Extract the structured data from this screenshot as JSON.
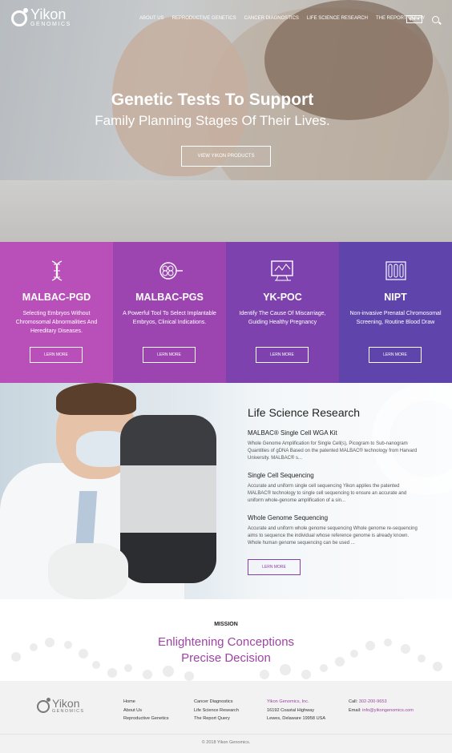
{
  "brand": {
    "name": "Yikon",
    "sub": "GENOMICS"
  },
  "nav": {
    "items": [
      "ABOUT US",
      "REPRODUCTIVE GENETICS",
      "CANCER DIAGNOSTICS",
      "LIFE SCIENCE RESEARCH",
      "THE REPORT QUERY"
    ],
    "lang": "EN",
    "lang_caret": "▾"
  },
  "hero": {
    "title": "Genetic Tests To Support",
    "subtitle": "Family Planning Stages Of Their Lives.",
    "button": "VIEW YIKON PRODUCTS"
  },
  "products": [
    {
      "title": "MALBAC-PGD",
      "desc": "Selecting Embryos Without Chromosomal Abnormalities And Hereditary Diseases.",
      "button": "LERN MORE",
      "icon": "dna-icon",
      "color": "#b94fb8"
    },
    {
      "title": "MALBAC-PGS",
      "desc": "A Powerful Tool To Select Implantable Embryos, Clinical Indications.",
      "button": "LERN MORE",
      "icon": "cells-icon",
      "color": "#9c45b0"
    },
    {
      "title": "YK-POC",
      "desc": "Identify The Cause Of Miscarriage, Guiding Healthy Pregnancy",
      "button": "LERN MORE",
      "icon": "microscope-screen-icon",
      "color": "#7d42ad"
    },
    {
      "title": "NIPT",
      "desc": "Non-invasive Prenatal Chromosomal Screening, Routine Blood Draw",
      "button": "LERN MORE",
      "icon": "test-tubes-icon",
      "color": "#5f44ab"
    }
  ],
  "life_science": {
    "heading": "Life Science Research",
    "items": [
      {
        "title": "MALBAC® Single Cell WGA Kit",
        "desc": "Whole Genome Amplification for Single Cell(s), Picogram to Sub-nanogram Quantities of gDNA Based on the patented MALBAC® technology from Harvard University. MALBAC® s..."
      },
      {
        "title": "Single Cell Sequencing",
        "desc": "Accurate and uniform single cell sequencing Yikon applies the patented MALBAC® technology to single cell sequencing to ensure an accurate and uniform whole-genome amplification of a sin..."
      },
      {
        "title": "Whole Genome Sequencing",
        "desc": "Accurate and uniform whole genome sequencing Whole genome re-sequencing aims to sequence the individual whose reference genome is already known. Whole human genome sequencing can be used ..."
      }
    ],
    "button": "LERN MORE"
  },
  "mission": {
    "label": "MISSION",
    "line1": "Enlightening Conceptions",
    "line2": "Precise Decision"
  },
  "footer": {
    "col1": [
      "Home",
      "About Us",
      "Reproductive Genetics"
    ],
    "col2": [
      "Cancer Diagnostics",
      "Life Science Research",
      "The Report Query"
    ],
    "company": "Yikon Genomics, Inc.",
    "address1": "16192 Coastal Highway",
    "address2": "Lewes, Delaware 19958 USA",
    "call_label": "Call:",
    "call": "302-200-9653",
    "email_label": "Email:",
    "email": "info@yikongenomics.com",
    "copyright": "© 2018 Yikon Genomics."
  },
  "colors": {
    "accent": "#9c45a3",
    "purple1": "#b94fb8",
    "purple2": "#9c45b0",
    "purple3": "#7d42ad",
    "purple4": "#5f44ab"
  }
}
